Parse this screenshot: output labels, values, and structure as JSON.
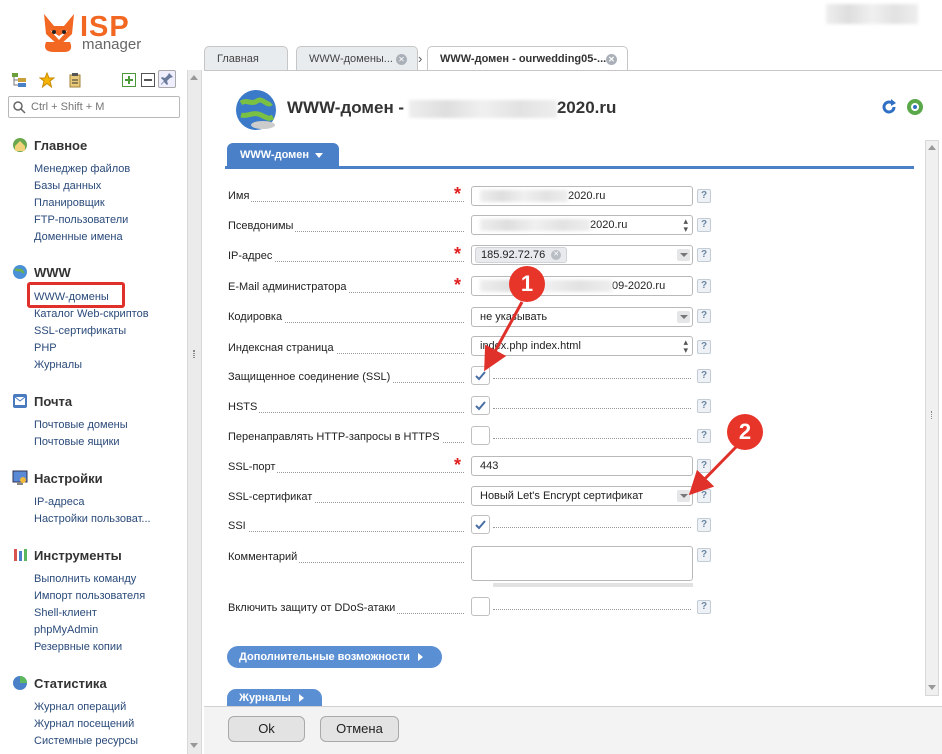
{
  "brand": {
    "isp": "ISP",
    "manager": "manager"
  },
  "colors": {
    "accent": "#4a80c8",
    "brand_orange": "#f26722",
    "annotation_red": "#e0302a"
  },
  "search": {
    "placeholder": "Ctrl + Shift + M"
  },
  "sidebar": {
    "sections": [
      {
        "title": "Главное",
        "icon": "home-icon",
        "items": [
          "Менеджер файлов",
          "Базы данных",
          "Планировщик",
          "FTP-пользователи",
          "Доменные имена"
        ]
      },
      {
        "title": "WWW",
        "icon": "globe-icon",
        "items": [
          "WWW-домены",
          "Каталог Web-скриптов",
          "SSL-сертификаты",
          "PHP",
          "Журналы"
        ]
      },
      {
        "title": "Почта",
        "icon": "mail-icon",
        "items": [
          "Почтовые домены",
          "Почтовые ящики"
        ]
      },
      {
        "title": "Настройки",
        "icon": "settings-icon",
        "items": [
          "IP-адреса",
          "Настройки пользоват..."
        ]
      },
      {
        "title": "Инструменты",
        "icon": "tools-icon",
        "items": [
          "Выполнить команду",
          "Импорт пользователя",
          "Shell-клиент",
          "phpMyAdmin",
          "Резервные копии"
        ]
      },
      {
        "title": "Статистика",
        "icon": "chart-pie-icon",
        "items": [
          "Журнал операций",
          "Журнал посещений",
          "Системные ресурсы"
        ]
      }
    ]
  },
  "tabs": [
    {
      "label": "Главная"
    },
    {
      "label": "WWW-домены..."
    },
    {
      "label": "WWW-домен - ourwedding05-..."
    }
  ],
  "page": {
    "title_prefix": "WWW-домен -",
    "title_suffix": "2020.ru"
  },
  "form": {
    "section_tab": "WWW-домен",
    "fields": [
      {
        "label": "Имя",
        "value": "2020.ru"
      },
      {
        "label": "Псевдонимы",
        "value": "2020.ru"
      },
      {
        "label": "IP-адрес",
        "value": "185.92.72.76"
      },
      {
        "label": "E-Mail администратора",
        "value": "09-2020.ru"
      },
      {
        "label": "Кодировка",
        "value": "не указывать"
      },
      {
        "label": "Индексная страница",
        "value": "index.php index.html"
      },
      {
        "label": "Защищенное соединение (SSL)",
        "checked": true
      },
      {
        "label": "HSTS",
        "checked": true
      },
      {
        "label": "Перенаправлять HTTP-запросы в HTTPS",
        "checked": false
      },
      {
        "label": "SSL-порт",
        "value": "443"
      },
      {
        "label": "SSL-сертификат",
        "value": "Новый Let's Encrypt сертификат"
      },
      {
        "label": "SSI",
        "checked": true
      },
      {
        "label": "Комментарий",
        "value": ""
      },
      {
        "label": "Включить защиту от DDoS-атаки",
        "checked": false
      }
    ],
    "help": "?"
  },
  "extra": {
    "more": "Дополнительные возможности",
    "logs": "Журналы"
  },
  "buttons": {
    "ok": "Ok",
    "cancel": "Отмена"
  },
  "annotations": [
    "1",
    "2"
  ]
}
